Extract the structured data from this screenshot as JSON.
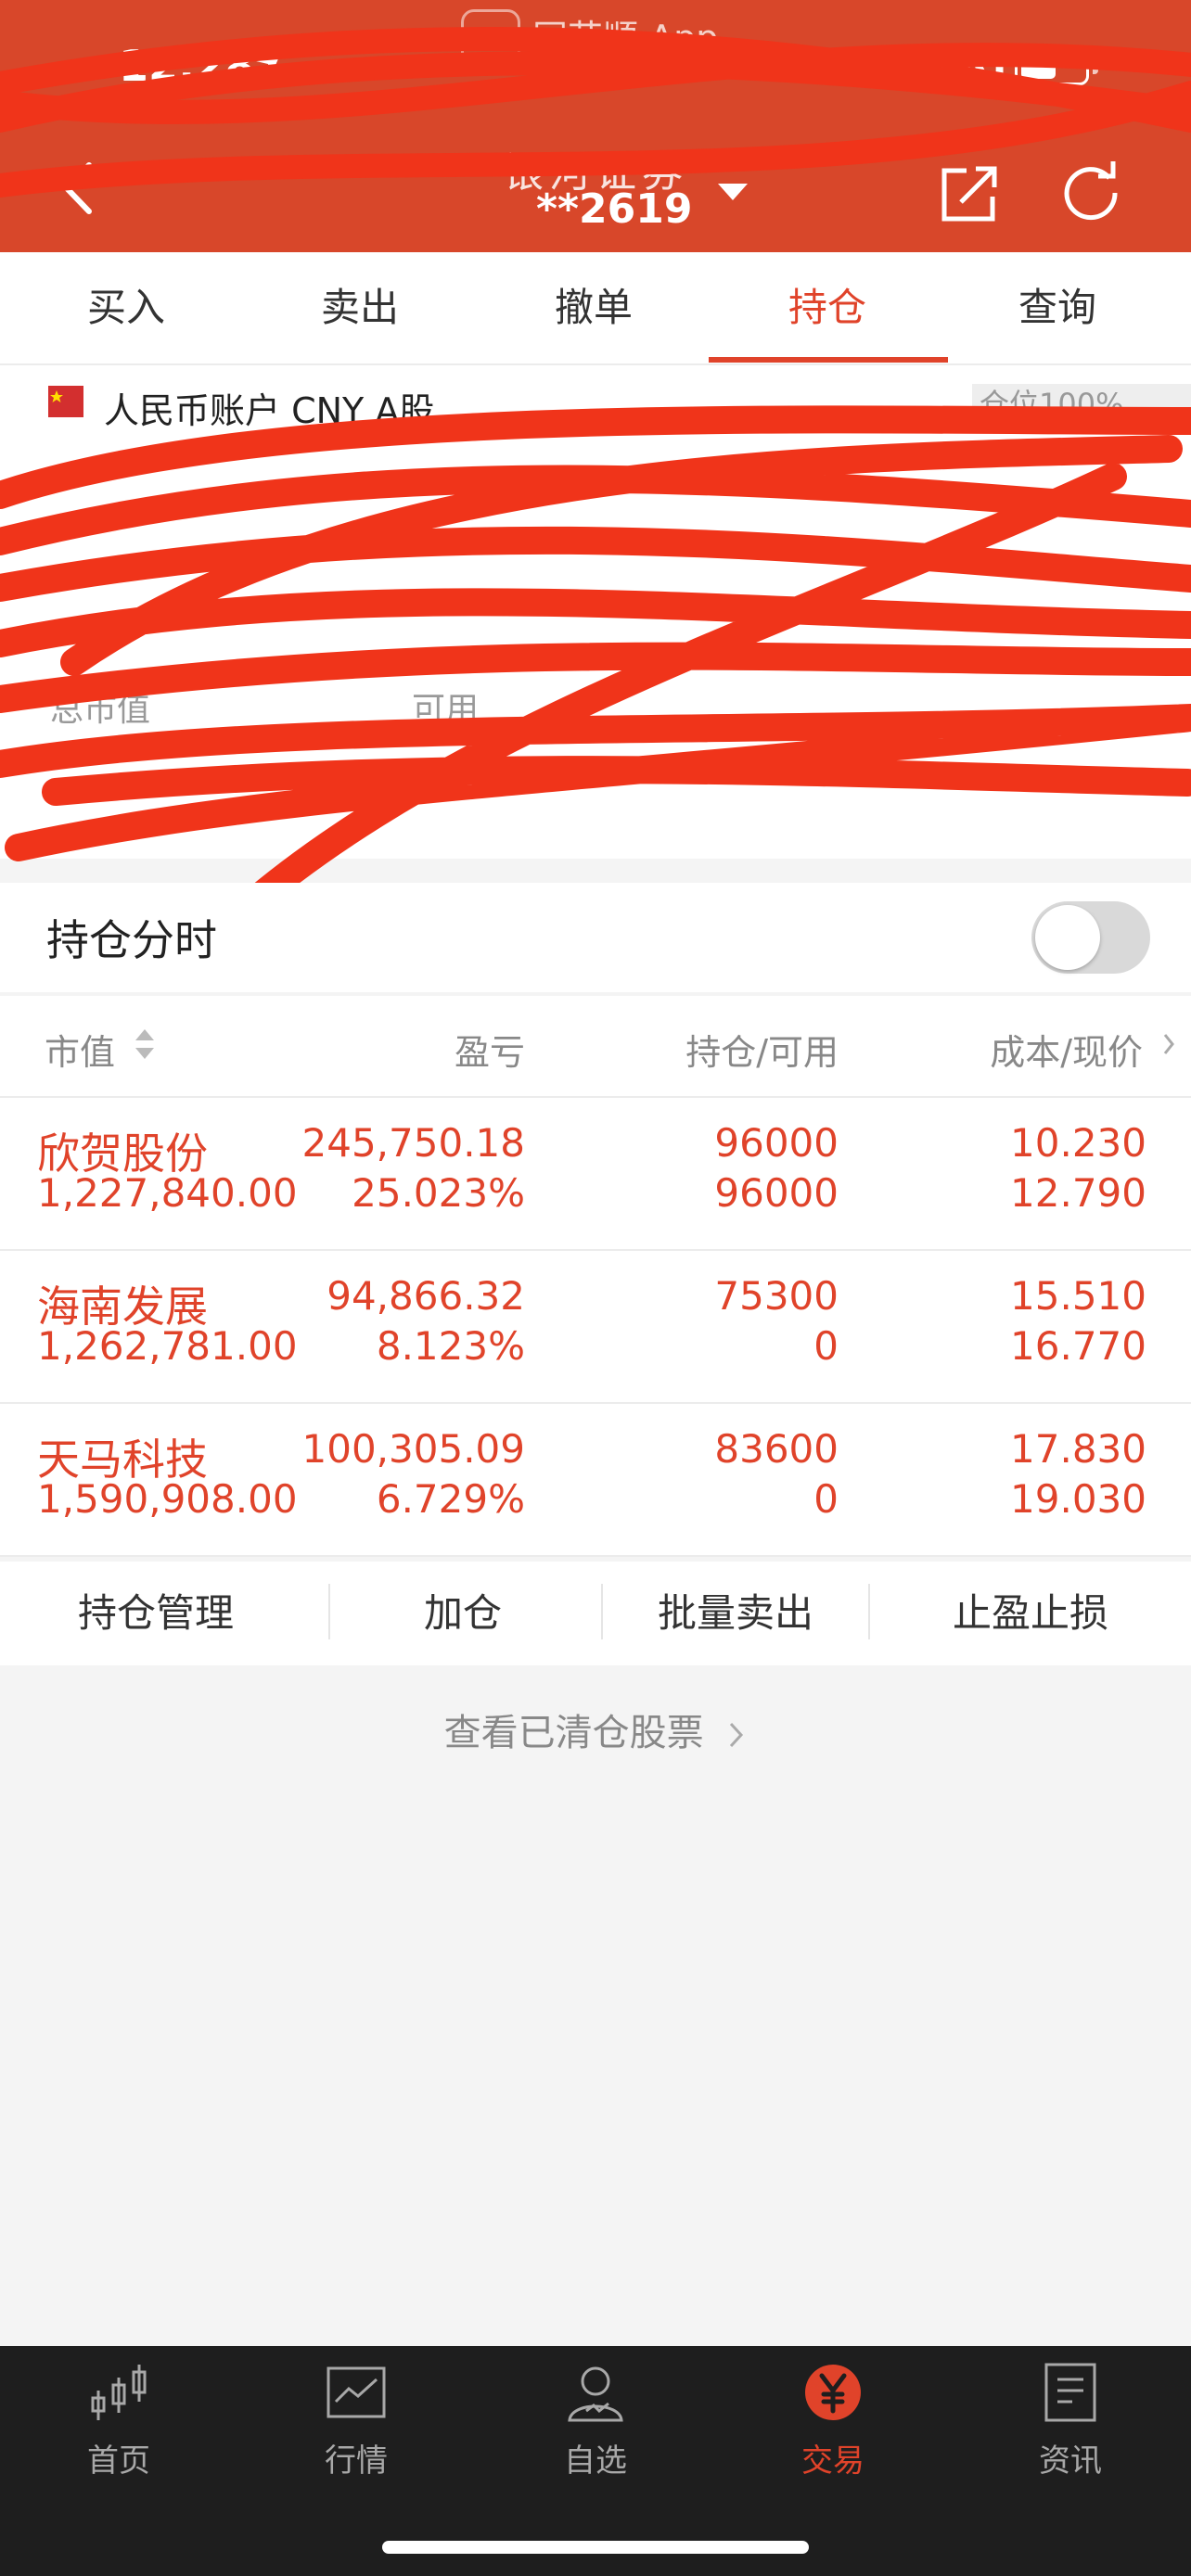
{
  "status_bar": {
    "time": "12:28",
    "source_app": "同花顺 App",
    "network": "5G",
    "battery_level": 0.55
  },
  "header": {
    "broker": "银河证券",
    "account": "**2619"
  },
  "tabs": [
    {
      "label": "买入",
      "active": false
    },
    {
      "label": "卖出",
      "active": false
    },
    {
      "label": "撤单",
      "active": false
    },
    {
      "label": "持仓",
      "active": true
    },
    {
      "label": "查询",
      "active": false
    }
  ],
  "account_summary": {
    "account_type": "人民币账户 CNY A股",
    "position_badge": "仓位100%",
    "total_market_value_label": "总市值",
    "available_label": "可用"
  },
  "intraday": {
    "label": "持仓分时",
    "enabled": false
  },
  "holdings_header": {
    "market_value": "市值",
    "profit_loss": "盈亏",
    "position_available": "持仓/可用",
    "cost_price": "成本/现价"
  },
  "holdings": [
    {
      "name": "欣贺股份",
      "market_value": "1,227,840.00",
      "profit_loss": "245,750.18",
      "profit_loss_ratio": "25.023%",
      "position": "96000",
      "available": "96000",
      "cost": "10.230",
      "price": "12.790"
    },
    {
      "name": "海南发展",
      "market_value": "1,262,781.00",
      "profit_loss": "94,866.32",
      "profit_loss_ratio": "8.123%",
      "position": "75300",
      "available": "0",
      "cost": "15.510",
      "price": "16.770"
    },
    {
      "name": "天马科技",
      "market_value": "1,590,908.00",
      "profit_loss": "100,305.09",
      "profit_loss_ratio": "6.729%",
      "position": "83600",
      "available": "0",
      "cost": "17.830",
      "price": "19.030"
    }
  ],
  "actions": [
    {
      "label": "持仓管理"
    },
    {
      "label": "加仓"
    },
    {
      "label": "批量卖出"
    },
    {
      "label": "止盈止损"
    }
  ],
  "cleared_stocks_link": "查看已清仓股票",
  "tab_bar": [
    {
      "label": "首页",
      "icon": "candlestick-icon",
      "active": false
    },
    {
      "label": "行情",
      "icon": "chart-icon",
      "active": false
    },
    {
      "label": "自选",
      "icon": "user-icon",
      "active": false
    },
    {
      "label": "交易",
      "icon": "yuan-icon",
      "active": true
    },
    {
      "label": "资讯",
      "icon": "document-icon",
      "active": false
    }
  ],
  "colors": {
    "brand_red": "#d8472a",
    "gain_red": "#e0432a",
    "redaction": "#f0341a"
  }
}
